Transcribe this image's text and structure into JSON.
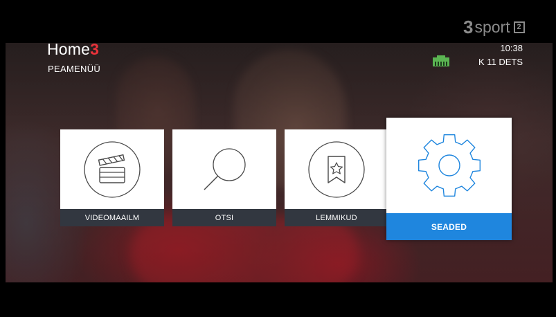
{
  "header": {
    "brand_word": "Home",
    "brand_mark": "3",
    "subtitle": "PEAMENÜÜ"
  },
  "channel": {
    "logo_mark": "3",
    "logo_word": "sport",
    "channel_number": "2"
  },
  "status": {
    "network_icon": "ethernet-icon",
    "time": "10:38",
    "date": "K 11 DETS"
  },
  "menu": {
    "items": [
      {
        "label": "VIDEOMAAILM",
        "icon": "clapperboard-icon",
        "selected": false
      },
      {
        "label": "OTSI",
        "icon": "search-icon",
        "selected": false
      },
      {
        "label": "LEMMIKUD",
        "icon": "favorites-star-icon",
        "selected": false
      },
      {
        "label": "SEADED",
        "icon": "gear-icon",
        "selected": true
      }
    ],
    "nav_icon": "chevron-left-icon"
  },
  "colors": {
    "accent": "#1f86de",
    "brand_red": "#e8323a",
    "label_bar": "#323740",
    "icon_stroke": "#4a4a4a",
    "network_green": "#4caf50"
  }
}
